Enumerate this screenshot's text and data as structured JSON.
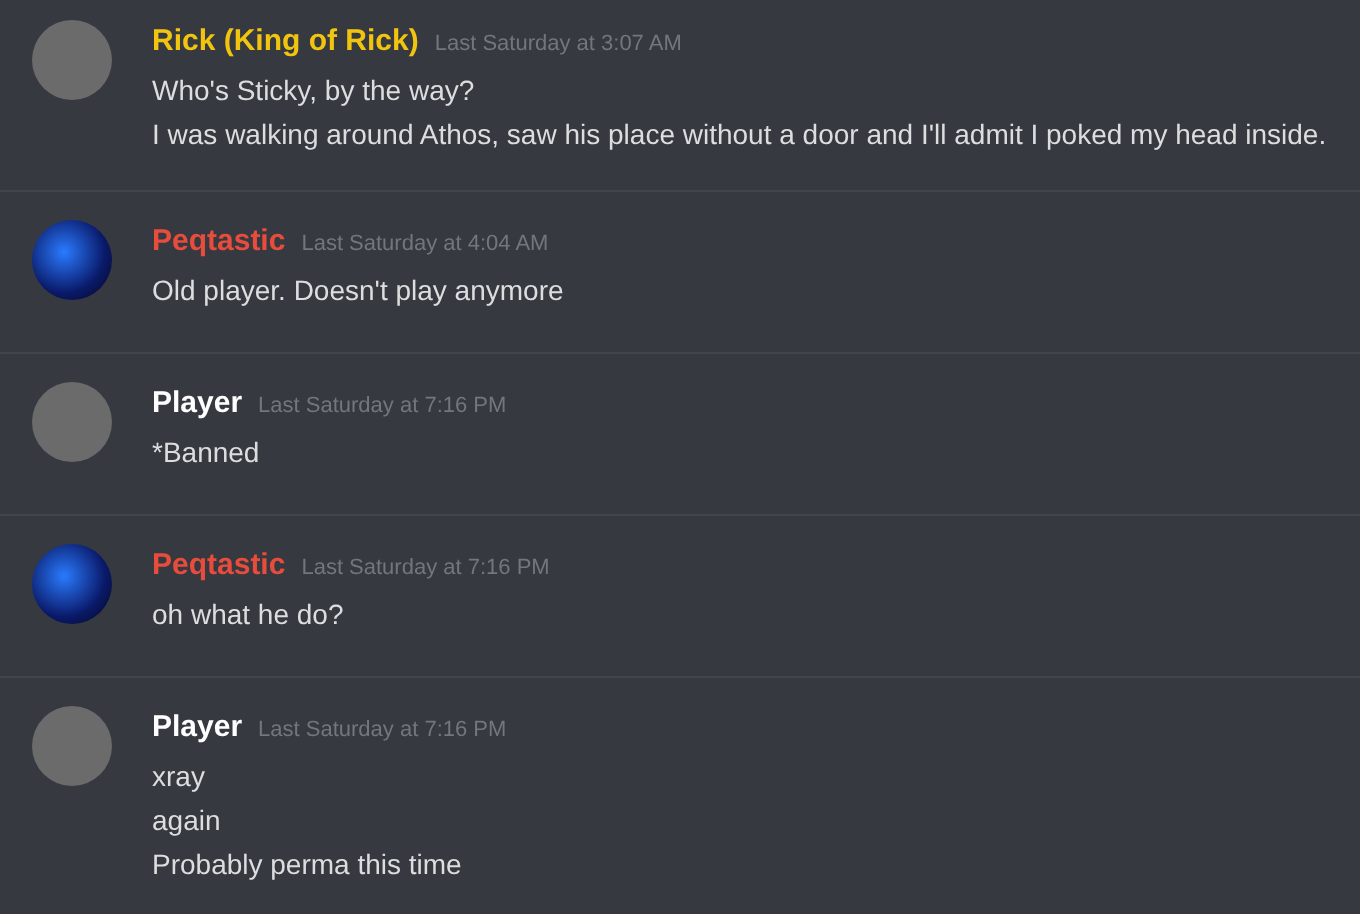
{
  "messages": [
    {
      "author": "Rick (King of Rick)",
      "color": "#f1c40f",
      "kind": "photo",
      "timestamp": "Last Saturday at 3:07 AM",
      "lines": [
        "Who's Sticky, by the way?",
        "I was walking around Athos, saw his place without a door and I'll admit I poked my head inside."
      ]
    },
    {
      "author": "Peqtastic",
      "color": "#e74c3c",
      "kind": "artwork",
      "timestamp": "Last Saturday at 4:04 AM",
      "lines": [
        "Old player. Doesn't play anymore"
      ]
    },
    {
      "author": "Player",
      "color": "#ffffff",
      "kind": "photo",
      "timestamp": "Last Saturday at 7:16 PM",
      "lines": [
        "*Banned"
      ]
    },
    {
      "author": "Peqtastic",
      "color": "#e74c3c",
      "kind": "artwork",
      "timestamp": "Last Saturday at 7:16 PM",
      "lines": [
        "oh what he do?"
      ]
    },
    {
      "author": "Player",
      "color": "#ffffff",
      "kind": "photo",
      "timestamp": "Last Saturday at 7:16 PM",
      "lines": [
        "xray",
        "again",
        "Probably perma this time"
      ]
    }
  ]
}
